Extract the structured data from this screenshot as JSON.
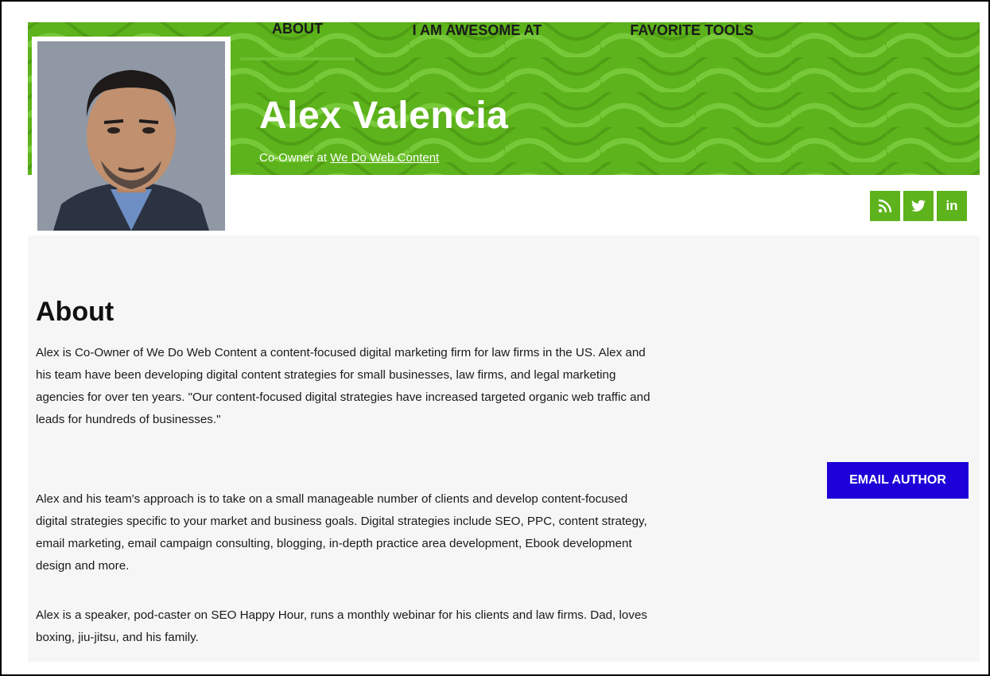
{
  "profile": {
    "name": "Alex Valencia",
    "subtitle_prefix": "Co-Owner at ",
    "company_link": "We Do Web Content"
  },
  "nav": {
    "tabs": [
      {
        "label": "ABOUT",
        "active": true
      },
      {
        "label": "I AM AWESOME AT",
        "active": false
      },
      {
        "label": "FAVORITE TOOLS",
        "active": false
      }
    ],
    "social": [
      {
        "icon": "rss-icon",
        "glyph": "℡"
      },
      {
        "icon": "twitter-icon",
        "glyph": "🐦"
      },
      {
        "icon": "linkedin-icon",
        "glyph": "in"
      }
    ]
  },
  "about": {
    "title": "About",
    "paragraphs": [
      "Alex is Co-Owner of We Do Web Content a content-focused digital marketing firm for law firms in the US. Alex and his team have been developing digital content strategies for small businesses, law firms, and legal marketing agencies for over ten years. \"Our content-focused digital strategies have increased targeted organic web traffic and leads for hundreds of businesses.\"",
      "Alex and his team's approach is to take on a small manageable number of clients and develop content-focused digital strategies specific to your market and business goals. Digital strategies include SEO, PPC, content strategy, email marketing, email campaign consulting, blogging, in-depth practice area development, Ebook development design and more.",
      "Alex is a speaker, pod-caster on SEO Happy Hour, runs a monthly webinar for his clients and law firms. Dad, loves boxing, jiu-jitsu, and his family."
    ]
  },
  "actions": {
    "email_label": "EMAIL AUTHOR"
  },
  "colors": {
    "brand_green": "#5db31b",
    "email_button": "#1e00d8",
    "content_bg": "#f6f6f6"
  }
}
